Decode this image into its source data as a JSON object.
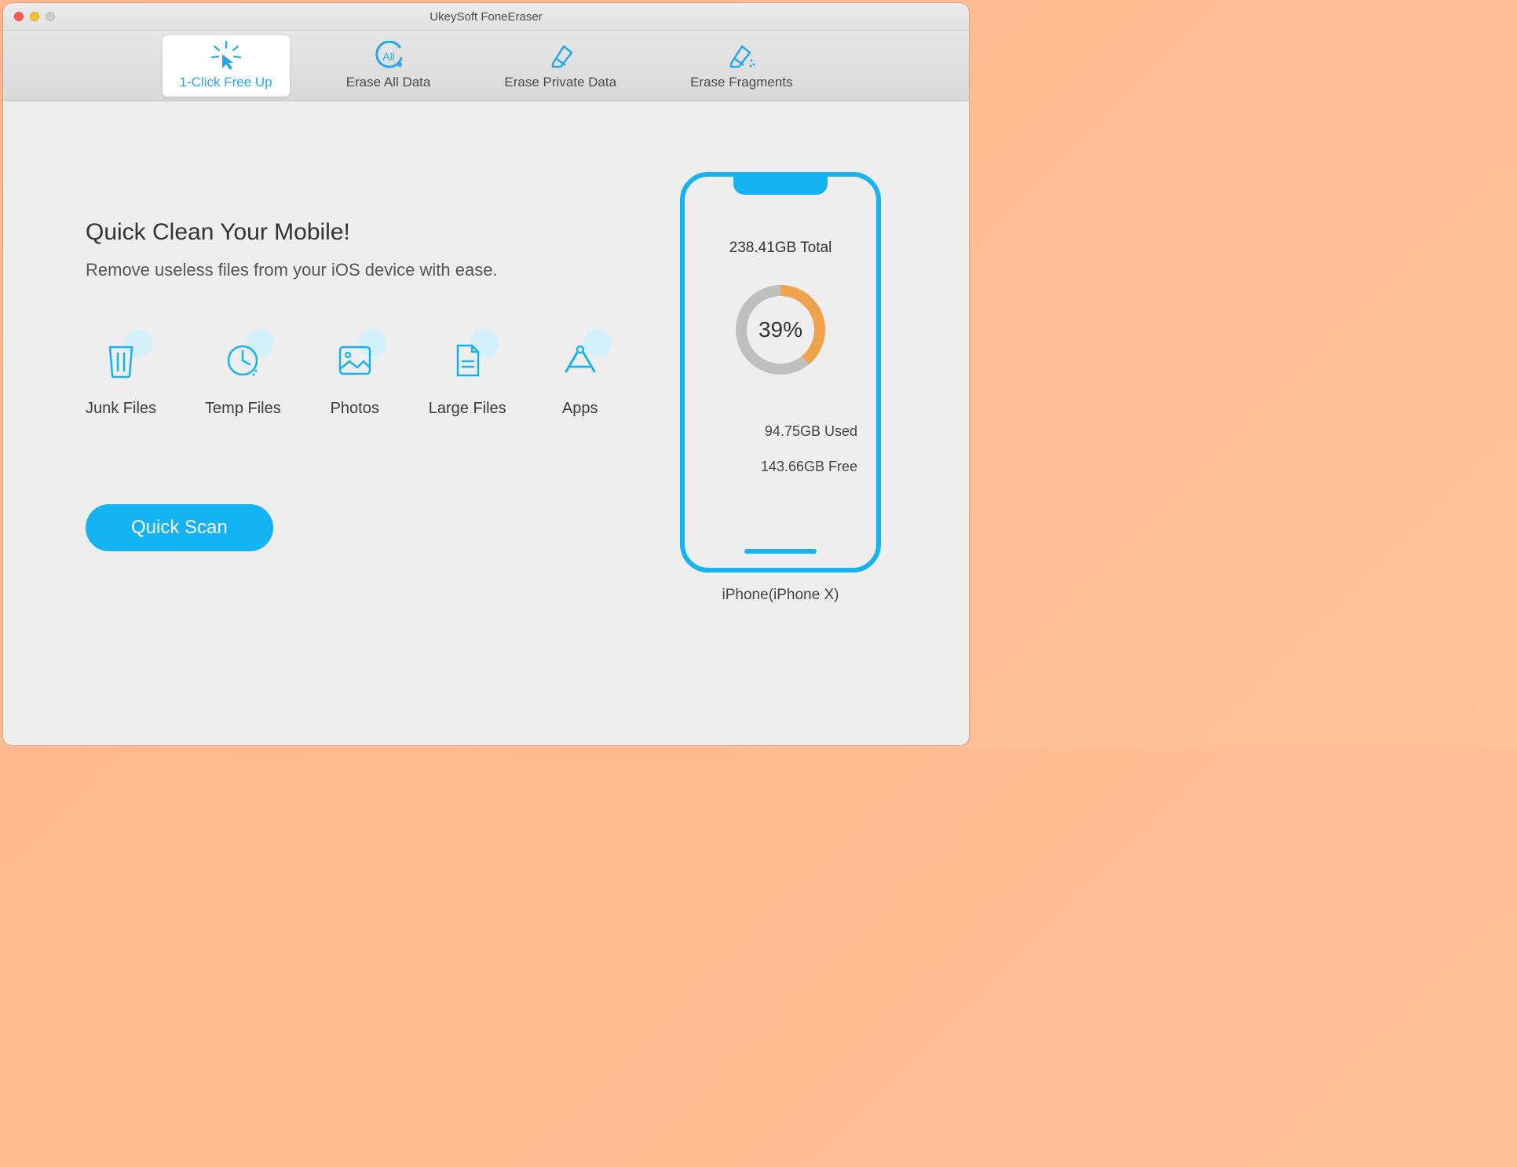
{
  "window_title": "UkeySoft FoneEraser",
  "tabs": {
    "free_up": "1-Click Free Up",
    "erase_all": "Erase All Data",
    "erase_private": "Erase Private Data",
    "erase_fragments": "Erase Fragments"
  },
  "main": {
    "heading": "Quick Clean Your Mobile!",
    "subheading": "Remove useless files from your iOS device with ease.",
    "categories": {
      "junk": "Junk Files",
      "temp": "Temp Files",
      "photos": "Photos",
      "large": "Large Files",
      "apps": "Apps"
    },
    "scan_button": "Quick Scan"
  },
  "device": {
    "total": "238.41GB Total",
    "percent_used": "39%",
    "used": "94.75GB Used",
    "free": "143.66GB Free",
    "name": "iPhone(iPhone X)"
  },
  "chart_data": {
    "type": "pie",
    "title": "Storage Usage",
    "series": [
      {
        "name": "Used",
        "value": 94.75,
        "unit": "GB",
        "percent": 39
      },
      {
        "name": "Free",
        "value": 143.66,
        "unit": "GB",
        "percent": 61
      }
    ],
    "total": 238.41,
    "total_unit": "GB"
  }
}
